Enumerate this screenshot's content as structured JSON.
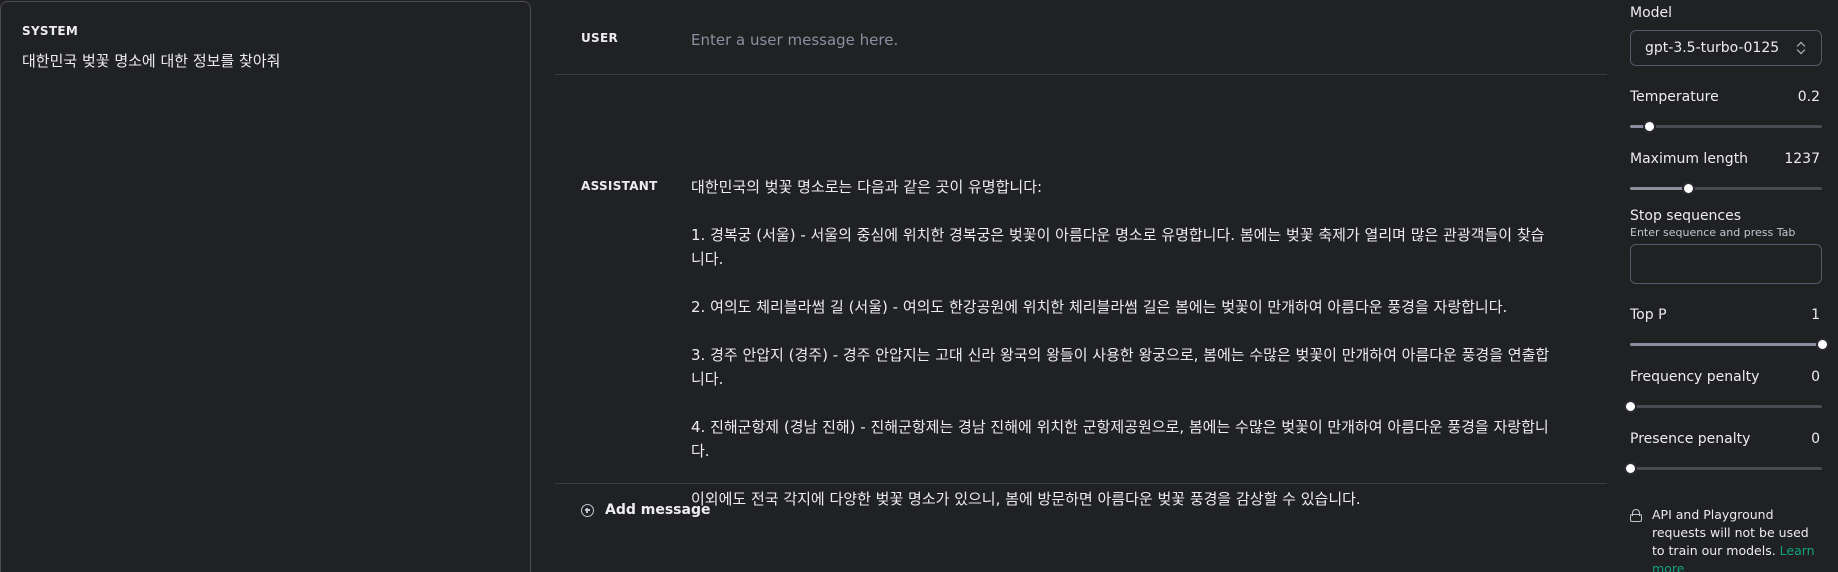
{
  "system": {
    "label": "SYSTEM",
    "text": "대한민국 벚꽃 명소에 대한 정보를 찾아줘"
  },
  "messages": {
    "user": {
      "role": "USER",
      "placeholder": "Enter a user message here.",
      "value": ""
    },
    "assistant": {
      "role": "ASSISTANT",
      "paragraphs": [
        "대한민국의 벚꽃 명소로는 다음과 같은 곳이 유명합니다:",
        "1. 경복궁 (서울) - 서울의 중심에 위치한 경복궁은 벚꽃이 아름다운 명소로 유명합니다. 봄에는 벚꽃 축제가 열리며 많은 관광객들이 찾습니다.",
        "2. 여의도 체리블라썸 길 (서울) - 여의도 한강공원에 위치한 체리블라썸 길은 봄에는 벚꽃이 만개하여 아름다운 풍경을 자랑합니다.",
        "3. 경주 안압지 (경주) - 경주 안압지는 고대 신라 왕국의 왕들이 사용한 왕궁으로, 봄에는 수많은 벚꽃이 만개하여 아름다운 풍경을 연출합니다.",
        "4. 진해군항제 (경남 진해) - 진해군항제는 경남 진해에 위치한 군항제공원으로, 봄에는 수많은 벚꽃이 만개하여 아름다운 풍경을 자랑합니다.",
        "이외에도 전국 각지에 다양한 벚꽃 명소가 있으니, 봄에 방문하면 아름다운 벚꽃 풍경을 감상할 수 있습니다."
      ]
    },
    "add_message_label": "Add message"
  },
  "settings": {
    "model_label": "Model",
    "model_value": "gpt-3.5-turbo-0125",
    "params": {
      "temperature": {
        "label": "Temperature",
        "value": "0.2",
        "fraction": 0.1
      },
      "max_length": {
        "label": "Maximum length",
        "value": "1237",
        "fraction": 0.3
      },
      "top_p": {
        "label": "Top P",
        "value": "1",
        "fraction": 1.0
      },
      "frequency_penalty": {
        "label": "Frequency penalty",
        "value": "0",
        "fraction": 0.0
      },
      "presence_penalty": {
        "label": "Presence penalty",
        "value": "0",
        "fraction": 0.0
      }
    },
    "stop_sequences": {
      "label": "Stop sequences",
      "hint": "Enter sequence and press Tab"
    },
    "notice": {
      "text": "API and Playground requests will not be used to train our models.",
      "link_label": "Learn more"
    }
  },
  "colors": {
    "background": "#202123",
    "link": "#10a37f",
    "border": "#4d4d4f"
  }
}
